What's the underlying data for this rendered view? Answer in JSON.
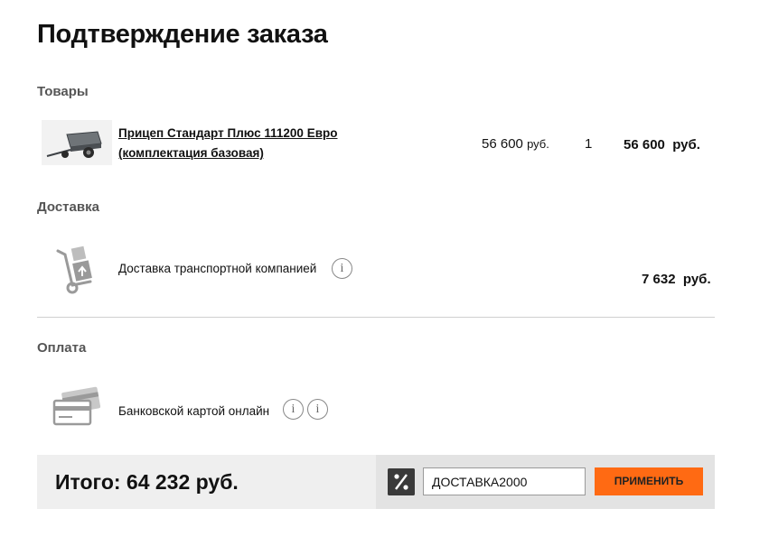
{
  "page": {
    "title": "Подтверждение заказа"
  },
  "sections": {
    "goods": "Товары",
    "delivery": "Доставка",
    "payment": "Оплата"
  },
  "product": {
    "name": "Прицеп Стандарт Плюс 111200 Евро (комплектация базовая)",
    "price_value": "56 600",
    "price_currency": "руб.",
    "quantity": "1",
    "total": "56 600  руб.",
    "icon": "trailer-image"
  },
  "delivery": {
    "method": "Доставка транспортной компанией",
    "info_glyph": "i",
    "price": "7 632  руб.",
    "icon": "hand-truck-icon"
  },
  "payment": {
    "method": "Банковской картой онлайн",
    "info_glyph_1": "i",
    "info_glyph_2": "i",
    "icon": "credit-cards-icon"
  },
  "summary": {
    "total": "Итого: 64 232 руб.",
    "promo_value": "ДОСТАВКА2000",
    "promo_icon": "percent-icon",
    "apply_label": "ПРИМЕНИТЬ"
  },
  "colors": {
    "accent": "#ff6a13",
    "bar_bg": "#efefef",
    "promo_bg": "#e3e3e3"
  }
}
